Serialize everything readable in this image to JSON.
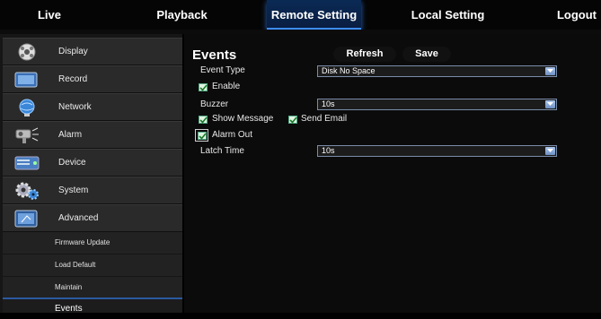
{
  "topnav": {
    "live": "Live",
    "playback": "Playback",
    "remote_setting": "Remote Setting",
    "local_setting": "Local Setting",
    "logout": "Logout"
  },
  "sidebar": {
    "items": [
      {
        "label": "Display",
        "icon": "display-icon"
      },
      {
        "label": "Record",
        "icon": "record-icon"
      },
      {
        "label": "Network",
        "icon": "network-icon"
      },
      {
        "label": "Alarm",
        "icon": "alarm-icon"
      },
      {
        "label": "Device",
        "icon": "device-icon"
      },
      {
        "label": "System",
        "icon": "system-icon"
      },
      {
        "label": "Advanced",
        "icon": "advanced-icon"
      }
    ],
    "subitems": [
      "Firmware Update",
      "Load Default",
      "Maintain",
      "Events"
    ]
  },
  "main": {
    "title": "Events",
    "refresh_label": "Refresh",
    "save_label": "Save",
    "event_type_label": "Event Type",
    "event_type_value": "Disk No Space",
    "enable_label": "Enable",
    "buzzer_label": "Buzzer",
    "buzzer_value": "10s",
    "show_message_label": "Show Message",
    "send_email_label": "Send Email",
    "alarm_out_label": "Alarm Out",
    "latch_time_label": "Latch Time",
    "latch_time_value": "10s"
  },
  "colors": {
    "accent": "#3c8cff",
    "panel": "#2a2a2a",
    "select_border": "#7a8caa"
  }
}
